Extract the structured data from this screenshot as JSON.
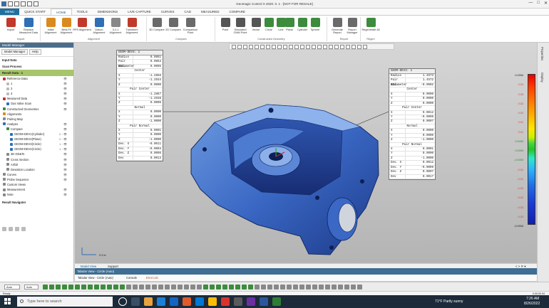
{
  "app": {
    "title": "Geomagic Control X 2020. 0. 1 - [NOT FOR RESALE]",
    "window_controls": [
      "—",
      "□",
      "✕"
    ]
  },
  "menu": {
    "file_tab": "MENU",
    "tabs": [
      "QUICK START",
      "HOME",
      "TOOLS",
      "DIMENSIONS",
      "LIVE CAPTURE",
      "CURVES",
      "CAD",
      "MEASURED",
      "COMPARE"
    ],
    "active": "HOME"
  },
  "ribbon": {
    "buttons": [
      {
        "label": "Import",
        "color": "#c0392b"
      },
      {
        "label": "Replace Measured Data",
        "color": "#2e6fb5"
      },
      {
        "label": "Initial Alignment",
        "color": "#d98b1f"
      },
      {
        "label": "Best-Fit Alignment",
        "color": "#d98b1f"
      },
      {
        "label": "RPS Alignment",
        "color": "#c0392b"
      },
      {
        "label": "Datum Alignment",
        "color": "#2e6fb5"
      },
      {
        "label": "3-2-1 Alignment",
        "color": "#888888"
      },
      {
        "label": "Transform Alignment",
        "color": "#c0392b"
      },
      {
        "label": "3D Compare",
        "color": "#6a6a6a"
      },
      {
        "label": "2D Compare",
        "color": "#6a6a6a"
      },
      {
        "label": "Comparison Point",
        "color": "#6a6a6a"
      },
      {
        "label": "Point",
        "color": "#555555"
      },
      {
        "label": "Simulated CMM Point",
        "color": "#555555"
      },
      {
        "label": "Vector",
        "color": "#555555"
      },
      {
        "label": "Circle",
        "color": "#3d8b3d"
      },
      {
        "label": "Line",
        "color": "#3d8b3d"
      },
      {
        "label": "Plane",
        "color": "#3d8b3d"
      },
      {
        "label": "Cylinder",
        "color": "#3d8b3d"
      },
      {
        "label": "Sphere",
        "color": "#3d8b3d"
      },
      {
        "label": "Generate Report",
        "color": "#6a6a6a"
      },
      {
        "label": "Report Manager",
        "color": "#6a6a6a"
      },
      {
        "label": "Regenerate All",
        "color": "#3d8b3d"
      }
    ],
    "groups": [
      "Import",
      "Alignment",
      "Compare",
      "Constructed Geometry",
      "Report",
      "Regen"
    ]
  },
  "panel": {
    "header": "Model Manager",
    "tabs": [
      "Model Manager",
      "Help"
    ],
    "input_data": "Input Data",
    "scan_process": "Scan Process",
    "result_data": "Result Data : 1",
    "tree": [
      {
        "label": "Reference Data",
        "indent": 0,
        "color": "#c0392b",
        "eye": "👁"
      },
      {
        "label": "1",
        "indent": 2,
        "color": "#bbbbbb",
        "eye": "👁"
      },
      {
        "label": "2",
        "indent": 2,
        "color": "#bbbbbb",
        "eye": "👁"
      },
      {
        "label": "3",
        "indent": 2,
        "color": "#bbbbbb",
        "eye": "👁"
      },
      {
        "label": "Measured Data",
        "indent": 0,
        "color": "#c0392b",
        "eye": "👁"
      },
      {
        "label": "Gas Valve Scan",
        "indent": 2,
        "color": "#2e6fb5",
        "eye": "👁"
      },
      {
        "label": "Constructed Geometries",
        "indent": 0,
        "color": "#3d8b3d",
        "eye": "👁"
      },
      {
        "label": "Alignments",
        "indent": 0,
        "color": "#d98b1f",
        "eye": ""
      },
      {
        "label": "Pairing Map",
        "indent": 0,
        "color": "#888888",
        "eye": ""
      },
      {
        "label": "Analysis",
        "indent": 0,
        "color": "#2e6fb5",
        "eye": "👁"
      },
      {
        "label": "Compare",
        "indent": 2,
        "color": "#3d8b3d",
        "eye": "👁"
      },
      {
        "label": "GEOM-DEV1(Cylinder)",
        "indent": 4,
        "color": "#2e6fb5",
        "eye": "2 ◦ 👁"
      },
      {
        "label": "GEOM-DEV2(Plane)",
        "indent": 4,
        "color": "#2e6fb5",
        "eye": "2 ◦ 👁"
      },
      {
        "label": "GEOM-DEV3(Circle)",
        "indent": 4,
        "color": "#2e6fb5",
        "eye": "1 ◦ 👁"
      },
      {
        "label": "GEOM-DEV4(Circle)",
        "indent": 4,
        "color": "#2e6fb5",
        "eye": "1 ◦ 👁"
      },
      {
        "label": "3D GD&Ts",
        "indent": 2,
        "color": "#888888",
        "eye": "👁"
      },
      {
        "label": "Cross Section",
        "indent": 2,
        "color": "#888888",
        "eye": "👁"
      },
      {
        "label": "Airfoil",
        "indent": 2,
        "color": "#888888",
        "eye": "👁"
      },
      {
        "label": "Deviation Location",
        "indent": 2,
        "color": "#888888",
        "eye": "👁"
      },
      {
        "label": "Curves",
        "indent": 0,
        "color": "#888888",
        "eye": "👁"
      },
      {
        "label": "Probe Sequence",
        "indent": 0,
        "color": "#888888",
        "eye": "👁"
      },
      {
        "label": "Custom Views",
        "indent": 0,
        "color": "#888888",
        "eye": ""
      },
      {
        "label": "Measurement",
        "indent": 0,
        "color": "#888888",
        "eye": "👁"
      },
      {
        "label": "Note",
        "indent": 0,
        "color": "#888888",
        "eye": "👁"
      }
    ],
    "result_navigator": "Result Navigator"
  },
  "callout_dev4": {
    "title": "GEOM-DEV4: 1",
    "rows_top": [
      [
        "Radius",
        "0.0851"
      ],
      [
        "Pair Rad.",
        "0.0853"
      ],
      [
        "ΔDiameter",
        "0.0005"
      ]
    ],
    "center_label": "Center",
    "center": [
      [
        "X",
        "-1.2856"
      ],
      [
        "Y",
        "-1.2934"
      ],
      [
        "Z",
        "0.0000"
      ]
    ],
    "pair_center_label": "Pair Center",
    "pair_center": [
      [
        "X",
        "-1.2867"
      ],
      [
        "Y",
        "-1.2938"
      ],
      [
        "Z",
        "0.0006"
      ]
    ],
    "normal_label": "Normal",
    "normal": [
      [
        "X",
        "0.0000"
      ],
      [
        "Y",
        "0.0000"
      ],
      [
        "Z",
        "-1.0000"
      ]
    ],
    "pair_normal_label": "Pair Normal",
    "pair_normal": [
      [
        "X",
        "0.0001"
      ],
      [
        "Y",
        "0.0000"
      ],
      [
        "Z",
        "-1.0000"
      ]
    ],
    "dev": [
      [
        "Dev. X",
        "-0.0011"
      ],
      [
        "Dev. Y",
        "-0.0004"
      ],
      [
        "Dev. Z",
        "0.0006"
      ],
      [
        "Dev",
        "0.0013"
      ]
    ]
  },
  "callout_dev3": {
    "title": "GEOM-DEV3: 1",
    "rows_top": [
      [
        "Radius",
        "1.4573"
      ],
      [
        "Pair Rad.",
        "1.4572"
      ],
      [
        "ΔDiameter",
        "-0.0002"
      ]
    ],
    "center_label": "Center",
    "center": [
      [
        "X",
        "0.0000"
      ],
      [
        "Y",
        "0.0000"
      ],
      [
        "Z",
        "0.0000"
      ]
    ],
    "pair_center_label": "Pair Center",
    "pair_center": [
      [
        "X",
        "0.0012"
      ],
      [
        "Y",
        "-0.0009"
      ],
      [
        "Z",
        "0.0007"
      ]
    ],
    "normal_label": "Normal",
    "normal": [
      [
        "X",
        "0.0000"
      ],
      [
        "Y",
        "0.0000"
      ],
      [
        "Z",
        "-1.0000"
      ]
    ],
    "pair_normal_label": "Pair Normal",
    "pair_normal": [
      [
        "X",
        "0.0001"
      ],
      [
        "Y",
        "0.0000"
      ],
      [
        "Z",
        "-1.0000"
      ]
    ],
    "dev": [
      [
        "Dev. X",
        "0.0012"
      ],
      [
        "Dev. Y",
        "-0.0009"
      ],
      [
        "Dev. Z",
        "0.0007"
      ],
      [
        "Dev",
        "0.0017"
      ]
    ]
  },
  "scale": {
    "labels_red": [
      "0.0334",
      "0.03",
      "0.03",
      "0.02",
      "0.02",
      "0.01",
      "0.01"
    ],
    "labels_green": [
      "0.0050",
      "0.0000",
      "-0.0050"
    ],
    "labels_blue": [
      "-0.01",
      "-0.01",
      "-0.02",
      "-0.02",
      "-0.03",
      "-0.03",
      "-0.0334"
    ]
  },
  "right_side": [
    "Properties",
    "Display"
  ],
  "triad_label": "0.5 in",
  "view_tabs": {
    "model": "Model View",
    "support": "Support",
    "controls": "< > ✕ ▾"
  },
  "tabular": {
    "title": "Tabular View - Circle (Auto)",
    "buttons": [
      "Tabular View - Circle (Auto)",
      "Console",
      "Error List"
    ]
  },
  "bottom_toolbar": {
    "dd1": "Auto",
    "dd2": "Auto"
  },
  "status": {
    "ready": "Ready",
    "time": "0:00:00.94"
  },
  "taskbar": {
    "search_placeholder": "Type here to search",
    "weather": "71°F  Partly sunny",
    "clock_time": "7:26 AM",
    "clock_date": "8/26/2022"
  }
}
